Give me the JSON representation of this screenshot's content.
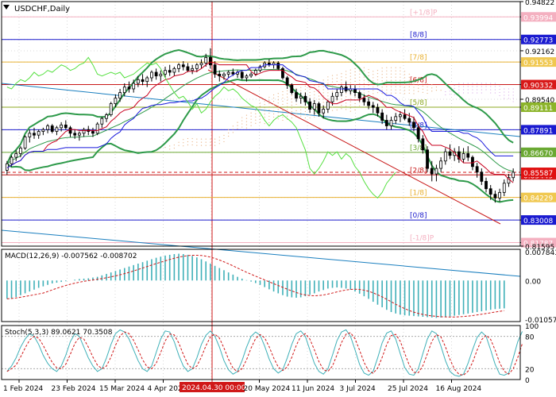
{
  "chart_data": {
    "type": "candlestick",
    "title": "USDCHF,Daily",
    "colors": {
      "grid": "#d8d8d8",
      "candle": "#000000",
      "tenkan": "#c8001e",
      "kijun": "#1a1adc",
      "chikou": "#55e040",
      "bollinger": "#2e9a4a",
      "cloud": "#e8b080",
      "macd_hist": "#3fb0b8",
      "macd_signal": "#d01818",
      "stoch_main": "#3fb0b8",
      "stoch_signal": "#d01818",
      "current_price_bg": "#e01010",
      "price_tag_bg": "#1a1ad0"
    },
    "price_axis": {
      "ticks": [
        {
          "label": "0.94822",
          "value": 0.94822
        },
        {
          "label": "0.93994",
          "value": 0.93994,
          "style": "tag",
          "bg": "#f4b0c0"
        },
        {
          "label": "0.92773",
          "value": 0.92773,
          "style": "tag",
          "bg": "#1a1ad0"
        },
        {
          "label": "0.92162",
          "value": 0.92162
        },
        {
          "label": "0.91553",
          "value": 0.91553,
          "style": "tag",
          "bg": "#f0c850"
        },
        {
          "label": "0.90332",
          "value": 0.90332,
          "style": "tag",
          "bg": "#d81818"
        },
        {
          "label": "0.89540",
          "value": 0.8954
        },
        {
          "label": "0.89111",
          "value": 0.89111,
          "style": "tag",
          "bg": "#8cb42a"
        },
        {
          "label": "0.87891",
          "value": 0.87891,
          "style": "tag",
          "bg": "#1a1ad0"
        },
        {
          "label": "0.86670",
          "value": 0.8667,
          "style": "tag",
          "bg": "#6aa832"
        },
        {
          "label": "0.85449",
          "value": 0.85449,
          "style": "tag",
          "bg": "#d81818"
        },
        {
          "label": "0.84229",
          "value": 0.84229,
          "style": "tag",
          "bg": "#f0c850"
        },
        {
          "label": "0.83008",
          "value": 0.83008,
          "style": "tag",
          "bg": "#1a1ad0"
        },
        {
          "label": "0.81787",
          "value": 0.81787,
          "style": "tag",
          "bg": "#f4b0c0"
        },
        {
          "label": "0.81595",
          "value": 0.81595
        }
      ],
      "current": {
        "label": "0.85587",
        "value": 0.85587
      }
    },
    "murrey_levels": [
      {
        "label": "[+2/8]P",
        "value": 0.95,
        "color": "#d040d0"
      },
      {
        "label": "[+1/8]P",
        "value": 0.93994,
        "color": "#f4b0c0"
      },
      {
        "label": "[8/8]",
        "value": 0.92773,
        "color": "#1a1acc"
      },
      {
        "label": "[7/8]",
        "value": 0.91553,
        "color": "#e8b030"
      },
      {
        "label": "[6/8]",
        "value": 0.90332,
        "color": "#c81818"
      },
      {
        "label": "[5/8]",
        "value": 0.89111,
        "color": "#8ca820"
      },
      {
        "label": "[4/8]",
        "value": 0.87891,
        "color": "#1a1acc"
      },
      {
        "label": "[3/8]",
        "value": 0.8667,
        "color": "#6aa832"
      },
      {
        "label": "[2/8]",
        "value": 0.85449,
        "color": "#c81818"
      },
      {
        "label": "[1/8]",
        "value": 0.84229,
        "color": "#e8b030"
      },
      {
        "label": "[0/8]",
        "value": 0.83008,
        "color": "#1a1acc"
      },
      {
        "label": "[-1/8]P",
        "value": 0.81787,
        "color": "#f4b0c0"
      }
    ],
    "x_axis": {
      "labels": [
        "1 Feb 2024",
        "23 Feb 2024",
        "15 Mar 2024",
        "4 Apr 2024",
        "2024.04.30 00:00",
        "20 May 2024",
        "11 Jun 2024",
        "3 Jul 2024",
        "25 Jul 2024",
        "16 Aug 2024"
      ],
      "highlighted": "2024.04.30 00:00"
    },
    "candles_ohlc": [
      [
        0.857,
        0.862,
        0.8545,
        0.8605
      ],
      [
        0.8605,
        0.865,
        0.859,
        0.864
      ],
      [
        0.864,
        0.868,
        0.862,
        0.866
      ],
      [
        0.866,
        0.87,
        0.864,
        0.869
      ],
      [
        0.869,
        0.876,
        0.868,
        0.875
      ],
      [
        0.875,
        0.879,
        0.872,
        0.877
      ],
      [
        0.877,
        0.88,
        0.874,
        0.876
      ],
      [
        0.876,
        0.879,
        0.874,
        0.878
      ],
      [
        0.878,
        0.88,
        0.876,
        0.879
      ],
      [
        0.879,
        0.882,
        0.877,
        0.881
      ],
      [
        0.881,
        0.882,
        0.877,
        0.878
      ],
      [
        0.878,
        0.881,
        0.876,
        0.88
      ],
      [
        0.88,
        0.883,
        0.878,
        0.8815
      ],
      [
        0.8815,
        0.884,
        0.879,
        0.88
      ],
      [
        0.88,
        0.881,
        0.875,
        0.877
      ],
      [
        0.877,
        0.879,
        0.874,
        0.876
      ],
      [
        0.876,
        0.878,
        0.873,
        0.877
      ],
      [
        0.877,
        0.88,
        0.875,
        0.879
      ],
      [
        0.879,
        0.881,
        0.876,
        0.878
      ],
      [
        0.878,
        0.88,
        0.875,
        0.877
      ],
      [
        0.877,
        0.883,
        0.876,
        0.882
      ],
      [
        0.882,
        0.886,
        0.88,
        0.885
      ],
      [
        0.885,
        0.888,
        0.883,
        0.887
      ],
      [
        0.887,
        0.894,
        0.886,
        0.893
      ],
      [
        0.893,
        0.898,
        0.891,
        0.896
      ],
      [
        0.896,
        0.901,
        0.894,
        0.899
      ],
      [
        0.899,
        0.904,
        0.897,
        0.902
      ],
      [
        0.902,
        0.905,
        0.899,
        0.901
      ],
      [
        0.901,
        0.906,
        0.899,
        0.904
      ],
      [
        0.904,
        0.908,
        0.902,
        0.906
      ],
      [
        0.906,
        0.909,
        0.903,
        0.905
      ],
      [
        0.905,
        0.908,
        0.902,
        0.907
      ],
      [
        0.907,
        0.911,
        0.905,
        0.91
      ],
      [
        0.91,
        0.912,
        0.906,
        0.908
      ],
      [
        0.908,
        0.911,
        0.905,
        0.909
      ],
      [
        0.909,
        0.913,
        0.907,
        0.911
      ],
      [
        0.911,
        0.914,
        0.908,
        0.91
      ],
      [
        0.91,
        0.913,
        0.908,
        0.912
      ],
      [
        0.912,
        0.915,
        0.91,
        0.914
      ],
      [
        0.914,
        0.916,
        0.911,
        0.913
      ],
      [
        0.913,
        0.915,
        0.91,
        0.911
      ],
      [
        0.911,
        0.914,
        0.909,
        0.912
      ],
      [
        0.912,
        0.915,
        0.91,
        0.914
      ],
      [
        0.914,
        0.917,
        0.912,
        0.915
      ],
      [
        0.915,
        0.92,
        0.913,
        0.918
      ],
      [
        0.918,
        0.923,
        0.912,
        0.914
      ],
      [
        0.914,
        0.916,
        0.907,
        0.909
      ],
      [
        0.909,
        0.911,
        0.905,
        0.908
      ],
      [
        0.908,
        0.91,
        0.906,
        0.909
      ],
      [
        0.909,
        0.911,
        0.907,
        0.91
      ],
      [
        0.91,
        0.912,
        0.908,
        0.909
      ],
      [
        0.909,
        0.911,
        0.907,
        0.91
      ],
      [
        0.91,
        0.911,
        0.906,
        0.907
      ],
      [
        0.907,
        0.909,
        0.905,
        0.908
      ],
      [
        0.908,
        0.91,
        0.907,
        0.909
      ],
      [
        0.909,
        0.912,
        0.908,
        0.911
      ],
      [
        0.911,
        0.914,
        0.91,
        0.913
      ],
      [
        0.913,
        0.916,
        0.912,
        0.915
      ],
      [
        0.915,
        0.917,
        0.913,
        0.914
      ],
      [
        0.914,
        0.916,
        0.912,
        0.915
      ],
      [
        0.915,
        0.916,
        0.911,
        0.912
      ],
      [
        0.912,
        0.913,
        0.906,
        0.907
      ],
      [
        0.907,
        0.908,
        0.901,
        0.903
      ],
      [
        0.903,
        0.904,
        0.898,
        0.899
      ],
      [
        0.899,
        0.901,
        0.894,
        0.896
      ],
      [
        0.896,
        0.899,
        0.893,
        0.897
      ],
      [
        0.897,
        0.899,
        0.892,
        0.894
      ],
      [
        0.894,
        0.896,
        0.888,
        0.89
      ],
      [
        0.89,
        0.895,
        0.887,
        0.893
      ],
      [
        0.893,
        0.894,
        0.886,
        0.888
      ],
      [
        0.888,
        0.892,
        0.885,
        0.89
      ],
      [
        0.89,
        0.895,
        0.888,
        0.894
      ],
      [
        0.894,
        0.899,
        0.892,
        0.897
      ],
      [
        0.897,
        0.901,
        0.895,
        0.899
      ],
      [
        0.899,
        0.903,
        0.897,
        0.902
      ],
      [
        0.902,
        0.905,
        0.899,
        0.9
      ],
      [
        0.9,
        0.903,
        0.898,
        0.901
      ],
      [
        0.901,
        0.903,
        0.897,
        0.899
      ],
      [
        0.899,
        0.9,
        0.894,
        0.896
      ],
      [
        0.896,
        0.898,
        0.892,
        0.894
      ],
      [
        0.894,
        0.896,
        0.89,
        0.892
      ],
      [
        0.892,
        0.894,
        0.888,
        0.891
      ],
      [
        0.891,
        0.893,
        0.886,
        0.888
      ],
      [
        0.888,
        0.89,
        0.882,
        0.884
      ],
      [
        0.884,
        0.887,
        0.879,
        0.881
      ],
      [
        0.881,
        0.886,
        0.879,
        0.884
      ],
      [
        0.884,
        0.888,
        0.882,
        0.886
      ],
      [
        0.886,
        0.889,
        0.883,
        0.887
      ],
      [
        0.887,
        0.89,
        0.884,
        0.885
      ],
      [
        0.885,
        0.888,
        0.881,
        0.883
      ],
      [
        0.883,
        0.886,
        0.878,
        0.88
      ],
      [
        0.88,
        0.882,
        0.872,
        0.874
      ],
      [
        0.874,
        0.876,
        0.866,
        0.868
      ],
      [
        0.868,
        0.87,
        0.856,
        0.858
      ],
      [
        0.858,
        0.862,
        0.851,
        0.855
      ],
      [
        0.855,
        0.86,
        0.851,
        0.858
      ],
      [
        0.858,
        0.864,
        0.856,
        0.862
      ],
      [
        0.862,
        0.869,
        0.86,
        0.867
      ],
      [
        0.867,
        0.871,
        0.863,
        0.865
      ],
      [
        0.865,
        0.869,
        0.862,
        0.867
      ],
      [
        0.867,
        0.87,
        0.861,
        0.863
      ],
      [
        0.863,
        0.869,
        0.861,
        0.866
      ],
      [
        0.866,
        0.87,
        0.862,
        0.864
      ],
      [
        0.864,
        0.865,
        0.857,
        0.859
      ],
      [
        0.859,
        0.861,
        0.853,
        0.856
      ],
      [
        0.856,
        0.858,
        0.849,
        0.851
      ],
      [
        0.851,
        0.853,
        0.845,
        0.847
      ],
      [
        0.847,
        0.849,
        0.841,
        0.844
      ],
      [
        0.844,
        0.846,
        0.8395,
        0.842
      ],
      [
        0.842,
        0.847,
        0.84,
        0.845
      ],
      [
        0.845,
        0.852,
        0.843,
        0.85
      ],
      [
        0.85,
        0.855,
        0.848,
        0.853
      ],
      [
        0.853,
        0.858,
        0.851,
        0.8559
      ]
    ],
    "macd": {
      "label": "MACD(12,26,9) -0.007562 -0.008702",
      "axis": [
        {
          "label": "0.007843",
          "value": 0.007843
        },
        {
          "label": "0.00",
          "value": 0
        },
        {
          "label": "-0.010574",
          "value": -0.010574
        }
      ],
      "hist": [
        -0.005,
        -0.0048,
        -0.0045,
        -0.004,
        -0.0035,
        -0.003,
        -0.0025,
        -0.002,
        -0.0016,
        -0.0012,
        -0.0008,
        -0.0006,
        -0.0004,
        -0.0002,
        0.0,
        0.0002,
        0.0004,
        0.0005,
        0.0006,
        0.0008,
        0.001,
        0.0014,
        0.0018,
        0.0022,
        0.0026,
        0.003,
        0.0034,
        0.0038,
        0.0042,
        0.0046,
        0.005,
        0.0054,
        0.0058,
        0.0062,
        0.0065,
        0.0068,
        0.007,
        0.0072,
        0.0073,
        0.0072,
        0.007,
        0.0067,
        0.0063,
        0.0058,
        0.0052,
        0.0046,
        0.004,
        0.0034,
        0.0028,
        0.0022,
        0.0016,
        0.001,
        0.0005,
        0.0001,
        -0.0003,
        -0.0007,
        -0.0012,
        -0.0018,
        -0.0024,
        -0.003,
        -0.0035,
        -0.004,
        -0.0044,
        -0.0046,
        -0.0047,
        -0.0046,
        -0.0043,
        -0.0039,
        -0.0035,
        -0.003,
        -0.0026,
        -0.0022,
        -0.002,
        -0.0019,
        -0.002,
        -0.0022,
        -0.0025,
        -0.003,
        -0.0036,
        -0.0043,
        -0.005,
        -0.0058,
        -0.0066,
        -0.0073,
        -0.008,
        -0.0086,
        -0.009,
        -0.0093,
        -0.0095,
        -0.0096,
        -0.0097,
        -0.0098,
        -0.0099,
        -0.01,
        -0.0101,
        -0.0102,
        -0.0101,
        -0.01,
        -0.0098,
        -0.0096,
        -0.0094,
        -0.0092,
        -0.009,
        -0.0088,
        -0.0086,
        -0.0084,
        -0.0082,
        -0.008,
        -0.0078,
        -0.0077,
        -0.0076
      ],
      "signal_note": "dashed red signal line"
    },
    "stochastic": {
      "label": "Stoch(5,3,3) 89.0621 70.3508",
      "axis": [
        {
          "label": "100",
          "value": 100
        },
        {
          "label": "80",
          "value": 80
        },
        {
          "label": "20",
          "value": 20
        },
        {
          "label": "0",
          "value": 0
        }
      ],
      "main": [
        15,
        25,
        40,
        60,
        75,
        85,
        80,
        65,
        45,
        30,
        20,
        15,
        25,
        45,
        70,
        85,
        80,
        60,
        40,
        25,
        15,
        20,
        40,
        65,
        85,
        92,
        88,
        75,
        55,
        35,
        20,
        15,
        25,
        50,
        75,
        90,
        88,
        70,
        45,
        25,
        15,
        20,
        40,
        65,
        82,
        90,
        80,
        60,
        35,
        18,
        10,
        15,
        35,
        60,
        80,
        88,
        82,
        62,
        38,
        20,
        12,
        18,
        40,
        65,
        85,
        90,
        80,
        55,
        30,
        15,
        10,
        20,
        45,
        72,
        88,
        92,
        80,
        55,
        28,
        12,
        8,
        15,
        40,
        68,
        86,
        90,
        75,
        48,
        22,
        10,
        8,
        20,
        48,
        75,
        90,
        85,
        62,
        35,
        15,
        8,
        6,
        10,
        30,
        55,
        78,
        88,
        80,
        55,
        28,
        10,
        8,
        12,
        40,
        70,
        89
      ],
      "signal_shift": 2
    }
  }
}
